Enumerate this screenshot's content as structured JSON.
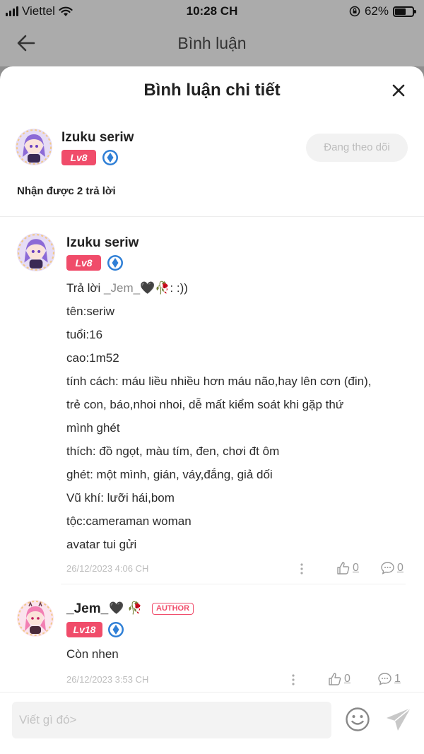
{
  "status_bar": {
    "carrier": "Viettel",
    "time": "10:28 CH",
    "battery": "62%",
    "battery_level": 0.62
  },
  "nav": {
    "title": "Bình luận"
  },
  "sheet": {
    "title": "Bình luận chi tiết"
  },
  "header_user": {
    "name": "Izuku seriw",
    "level": "Lv8",
    "follow_label": "Đang theo dõi"
  },
  "reply_count": "Nhận được 2 trả lời",
  "comments": [
    {
      "name": "Izuku seriw",
      "level": "Lv8",
      "mention_prefix": "Trả lời ",
      "mention": "_Jem_",
      "mention_suffix": ": :))",
      "lines": [
        "tên:seriw",
        "tuổi:16",
        "cao:1m52",
        "tính cách: máu liều nhiều hơn máu não,hay lên cơn (đin),",
        "trẻ con, báo,nhoi nhoi, dễ mất kiểm soát khi gặp thứ",
        "mình ghét",
        "thích: đồ ngọt, màu tím, đen, chơi đt ôm",
        "ghét: một mình, gián, váy,đắng, giả dối",
        "Vũ khí: lưỡi hái,bom",
        "tộc:cameraman woman",
        "avatar tui gửi"
      ],
      "timestamp": "26/12/2023 4:06 CH",
      "likes": "0",
      "replies": "0"
    },
    {
      "name": "_Jem_",
      "level": "Lv18",
      "author_tag": "AUTHOR",
      "text": "Còn nhen",
      "timestamp": "26/12/2023 3:53 CH",
      "likes": "0",
      "replies": "1"
    }
  ],
  "input": {
    "placeholder": "Viết gì đó>"
  },
  "colors": {
    "level_badge": "#f04c6a",
    "verified_badge": "#2f7fd6",
    "overlay_bg": "#ababab"
  },
  "icons": [
    "back-arrow-icon",
    "close-icon",
    "wifi-icon",
    "lock-rotation-icon",
    "battery-icon",
    "verified-badge-icon",
    "more-dots-icon",
    "thumb-up-icon",
    "comment-bubble-icon",
    "emoji-icon",
    "send-icon",
    "black-heart-emoji",
    "rose-emoji"
  ]
}
